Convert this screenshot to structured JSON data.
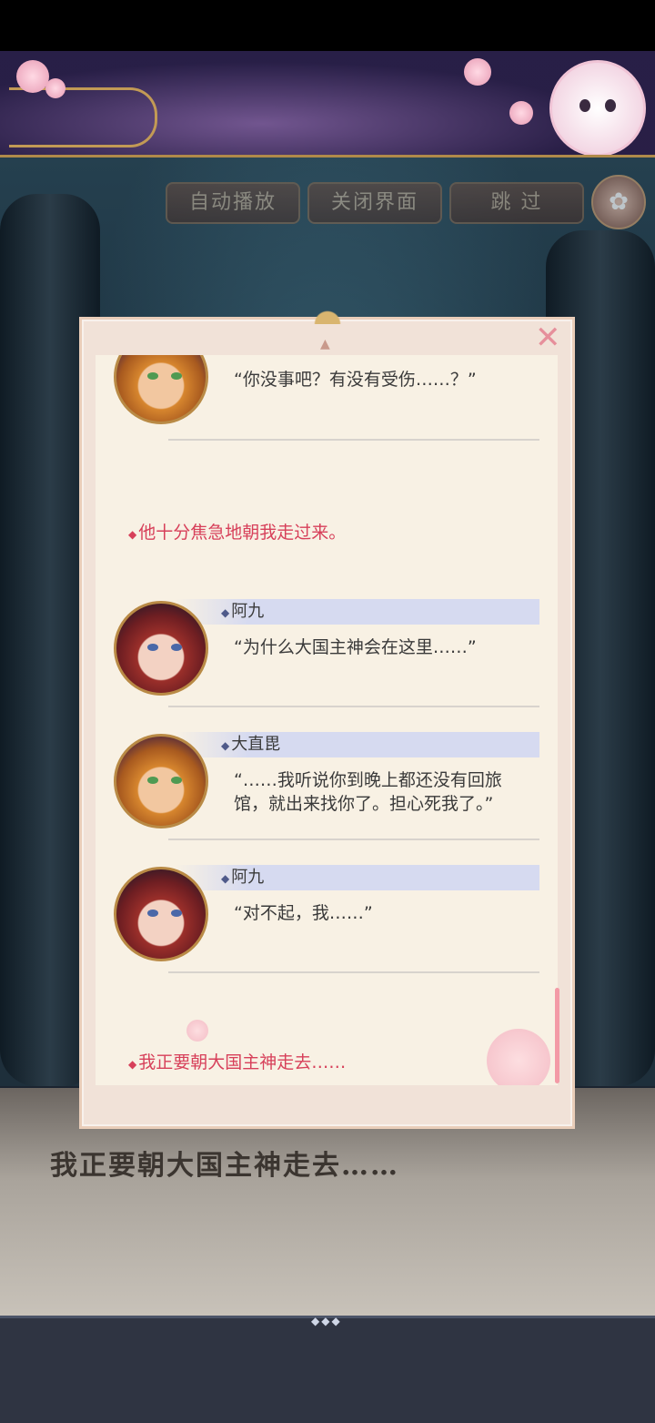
{
  "toolbar": {
    "auto_play": "自动播放",
    "close_ui": "关闭界面",
    "skip": "跳 过"
  },
  "backlog": {
    "close_symbol": "✕",
    "entries": [
      {
        "type": "dialog",
        "speaker": "",
        "text": "“你没事吧？有没有受伤……？”",
        "avatar": "orange"
      },
      {
        "type": "narration",
        "text": "他十分焦急地朝我走过来。"
      },
      {
        "type": "dialog",
        "speaker": "阿九",
        "text": "“为什么大国主神会在这里……”",
        "avatar": "red"
      },
      {
        "type": "dialog",
        "speaker": "大直毘",
        "text": "“……我听说你到晚上都还没有回旅馆，就出来找你了。担心死我了。”",
        "avatar": "orange"
      },
      {
        "type": "dialog",
        "speaker": "阿九",
        "text": "“对不起，我……”",
        "avatar": "red"
      },
      {
        "type": "narration",
        "text": "我正要朝大国主神走去……"
      }
    ]
  },
  "scene": {
    "narration_text": "我正要朝大国主神走去……"
  },
  "colors": {
    "narration": "#d7405a",
    "panel_bg": "#f8f1e4",
    "name_bar": "#d6daf0"
  },
  "icons": {
    "settings": "gear-icon",
    "close": "close-icon"
  }
}
